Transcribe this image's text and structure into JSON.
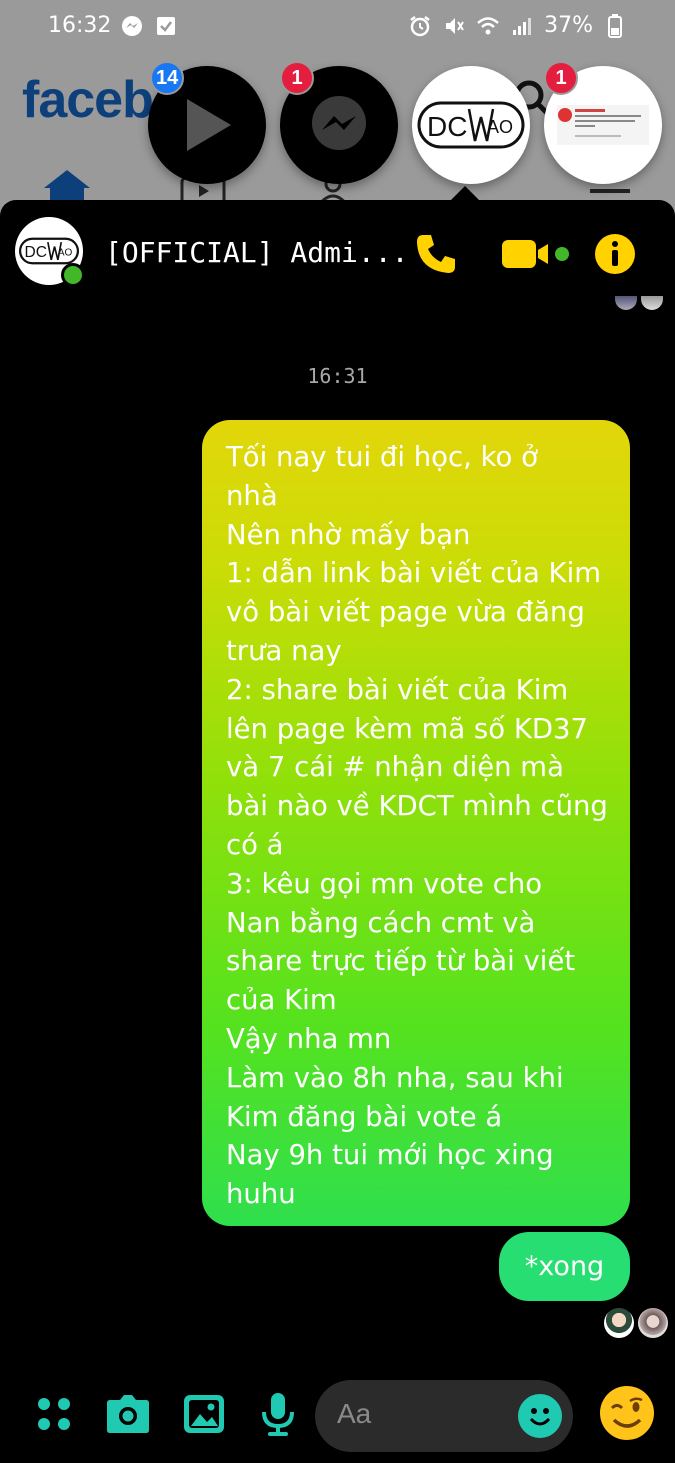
{
  "status_bar": {
    "time": "16:32",
    "battery": "37%",
    "icons": [
      "messenger-icon",
      "check-box-icon",
      "alarm-icon",
      "mute-icon",
      "wifi-icon",
      "signal-icon",
      "battery-icon"
    ]
  },
  "background_app": {
    "logo": "faceb"
  },
  "chat_heads": [
    {
      "name": "video-head",
      "badge": "14",
      "badge_color": "#1877f2"
    },
    {
      "name": "messenger-head",
      "badge": "1",
      "badge_color": "#e41e3f"
    },
    {
      "name": "dcwao-head",
      "logo_text": "DCWAO"
    },
    {
      "name": "post-preview-head",
      "badge": "1",
      "badge_color": "#e41e3f"
    }
  ],
  "chat": {
    "title": "[OFFICIAL] Admi...",
    "avatar_text": "DCWAO",
    "online": true,
    "accent_color": "#ffd200",
    "timestamp": "16:31",
    "message_lines": [
      "Tối nay tui đi học, ko ở",
      "nhà",
      "Nên nhờ mấy bạn",
      "1: dẫn link bài viết của Kim",
      "vô bài viết page vừa đăng",
      "trưa nay",
      "2: share bài viết của Kim",
      "lên page kèm mã số KD37",
      "và 7 cái # nhận diện mà",
      "bài nào về KDCT mình cũng",
      "có á",
      "3: kêu gọi mn vote cho",
      "Nan bằng cách cmt và",
      "share trực tiếp từ bài viết",
      "của Kim",
      "Vậy nha mn",
      "Làm vào 8h nha, sau khi",
      "Kim đăng bài vote á",
      "Nay 9h tui mới học xing",
      "huhu"
    ],
    "followup": "*xong"
  },
  "composer": {
    "placeholder": "Aa",
    "icon_color": "#20c9b1",
    "buttons": [
      "menu-dots-icon",
      "camera-icon",
      "gallery-icon",
      "microphone-icon",
      "emoji-icon",
      "wink-emoji-icon"
    ]
  }
}
